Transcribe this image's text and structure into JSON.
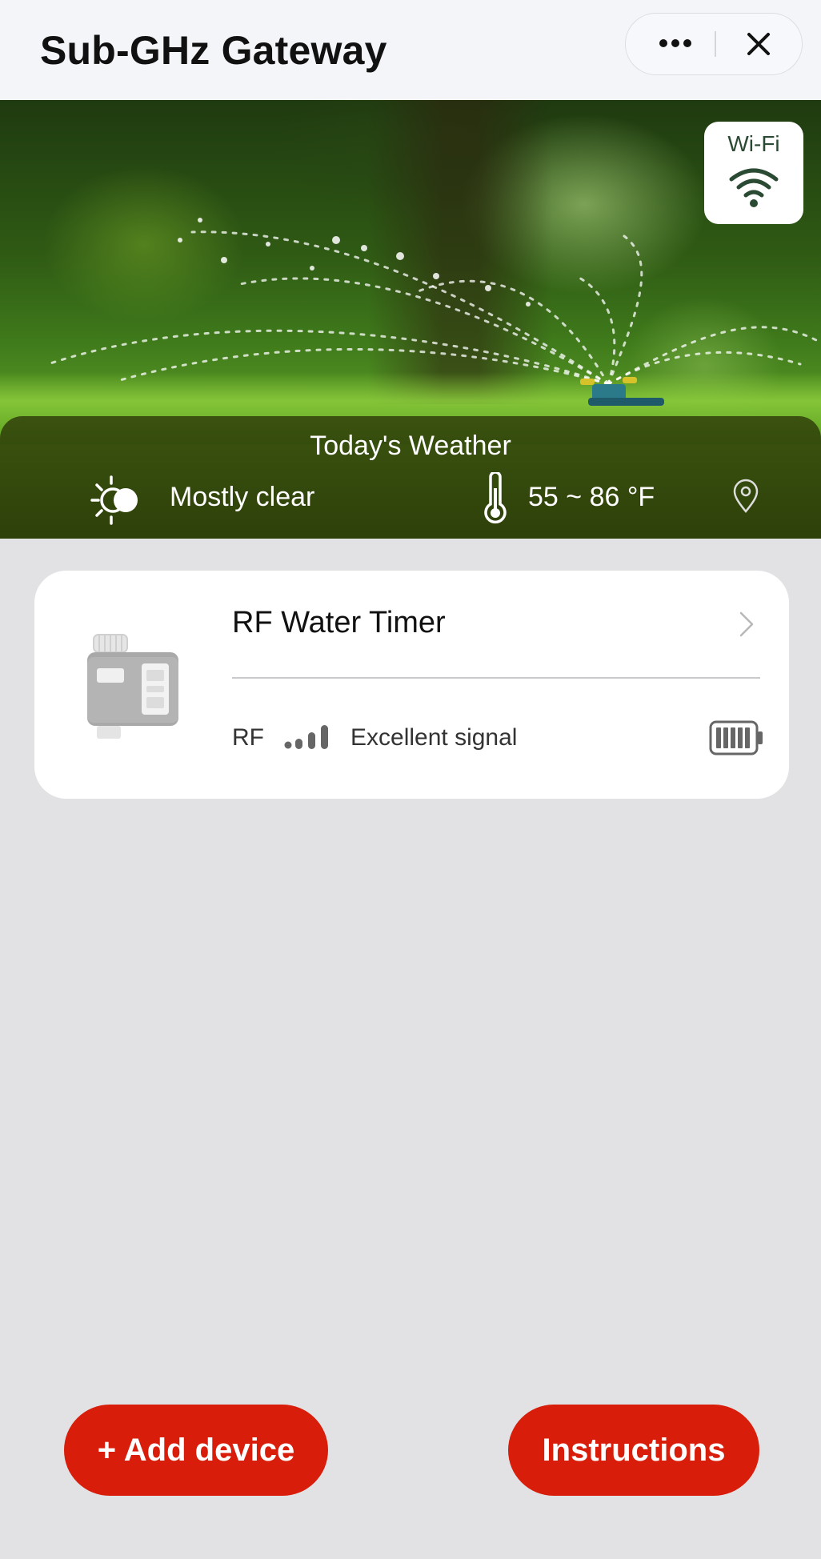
{
  "header": {
    "title": "Sub-GHz Gateway",
    "more_icon": "more-dots-icon",
    "close_icon": "close-icon"
  },
  "hero": {
    "background": "garden-sprinkler-photo",
    "wifi": {
      "label": "Wi-Fi",
      "icon": "wifi-icon"
    },
    "weather": {
      "title": "Today's Weather",
      "condition": "Mostly clear",
      "condition_icon": "partly-sunny-icon",
      "temperature": "55 ~ 86 °F",
      "temperature_icon": "thermometer-icon",
      "location_icon": "location-pin-icon"
    }
  },
  "device": {
    "name": "RF Water Timer",
    "protocol": "RF",
    "signal_text": "Excellent signal",
    "signal_icon": "signal-bars-icon",
    "battery_icon": "battery-full-icon",
    "chevron_icon": "chevron-right-icon"
  },
  "actions": {
    "add_device": "+ Add device",
    "instructions": "Instructions"
  },
  "colors": {
    "accent": "#d81e0b",
    "header_bg": "#f4f5f9",
    "page_bg": "#e2e2e4",
    "wifi_text": "#2a4a33"
  }
}
